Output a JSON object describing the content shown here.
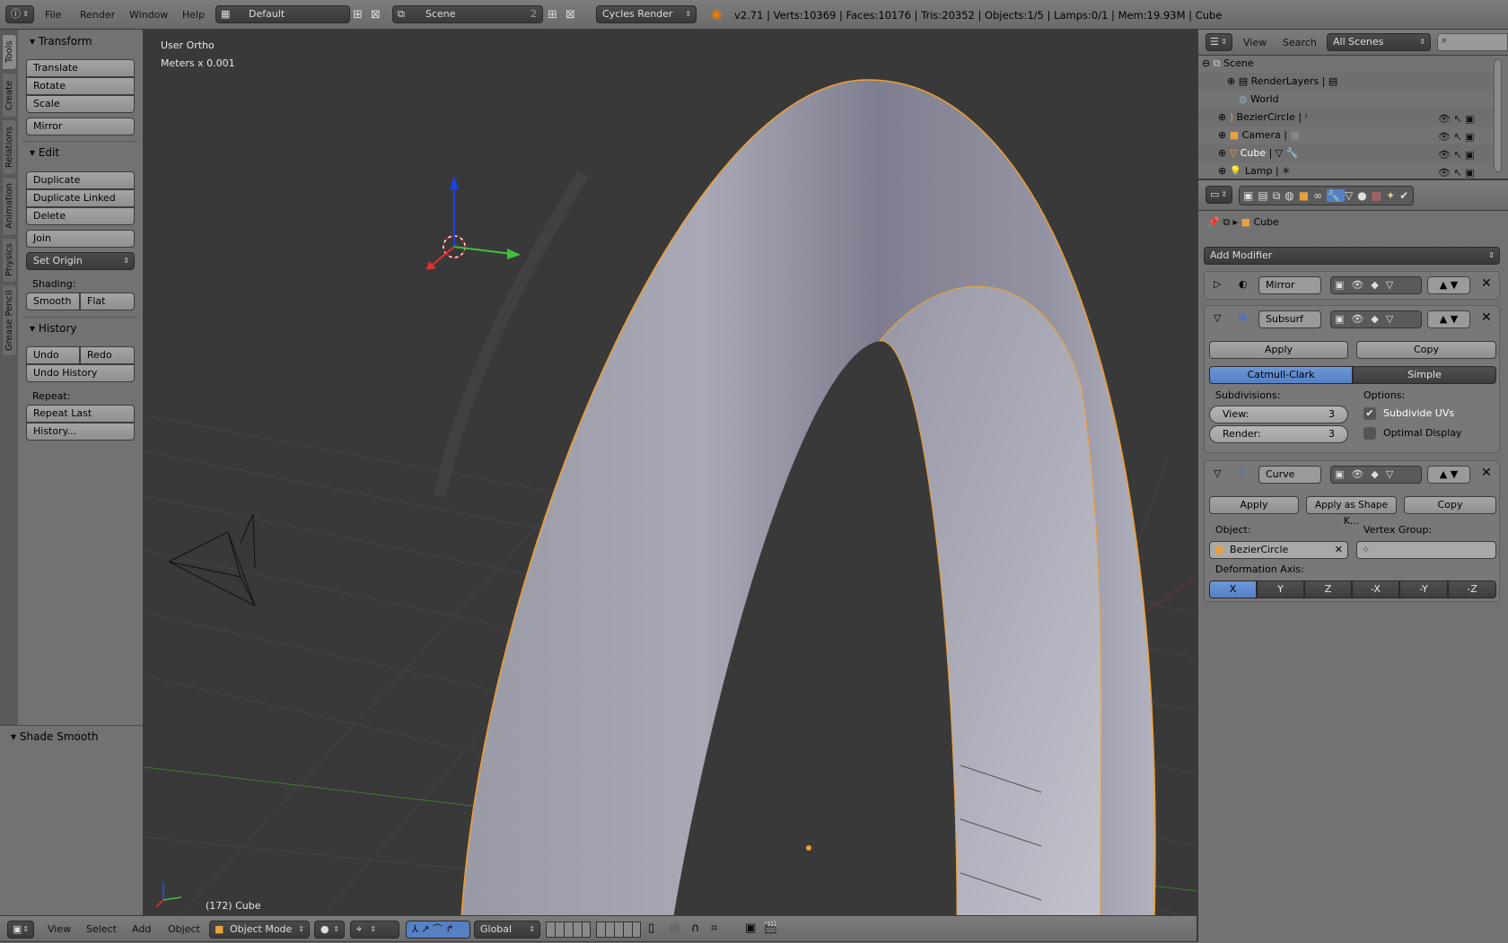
{
  "top_header": {
    "menus": [
      "File",
      "Render",
      "Window",
      "Help"
    ],
    "layout": "Default",
    "scene": "Scene",
    "scene_users": "2",
    "engine": "Cycles Render",
    "stats": "v2.71 | Verts:10369 | Faces:10176 | Tris:20352 | Objects:1/5 | Lamps:0/1 | Mem:19.93M | Cube"
  },
  "tool_tabs": [
    "Tools",
    "Create",
    "Relations",
    "Animation",
    "Physics",
    "Grease Pencil"
  ],
  "toolshelf": {
    "transform": {
      "title": "Transform",
      "buttons": [
        "Translate",
        "Rotate",
        "Scale",
        "Mirror"
      ]
    },
    "edit": {
      "title": "Edit",
      "buttons": [
        "Duplicate",
        "Duplicate Linked",
        "Delete",
        "Join"
      ],
      "set_origin": "Set Origin",
      "shading_label": "Shading:",
      "smooth": "Smooth",
      "flat": "Flat"
    },
    "history": {
      "title": "History",
      "undo": "Undo",
      "redo": "Redo",
      "undo_history": "Undo History",
      "repeat_label": "Repeat:",
      "repeat_last": "Repeat Last",
      "history": "History..."
    },
    "operator": {
      "title": "Shade Smooth"
    }
  },
  "viewport": {
    "view_name": "User Ortho",
    "units": "Meters x 0.001",
    "object_info": "(172) Cube",
    "colors": {
      "background": "#393939",
      "selection_outline": "#f0a030",
      "x_axis": "#c03030",
      "y_axis": "#50b030"
    }
  },
  "bottom_header": {
    "menus": [
      "View",
      "Select",
      "Add",
      "Object"
    ],
    "mode": "Object Mode",
    "orientation": "Global"
  },
  "outliner": {
    "menus": [
      "View",
      "Search"
    ],
    "display": "All Scenes",
    "search_placeholder": "",
    "items": [
      {
        "name": "Scene",
        "icon": "scene-icon"
      },
      {
        "name": "RenderLayers",
        "icon": "renderlayers-icon"
      },
      {
        "name": "World",
        "icon": "world-icon"
      },
      {
        "name": "BezierCircle",
        "icon": "curve-icon"
      },
      {
        "name": "Camera",
        "icon": "camera-icon"
      },
      {
        "name": "Cube",
        "icon": "mesh-icon",
        "selected": true
      },
      {
        "name": "Lamp",
        "icon": "lamp-icon"
      }
    ]
  },
  "properties": {
    "context_object": "Cube",
    "active_tab": "modifiers",
    "add_modifier": "Add Modifier",
    "modifiers": [
      {
        "name": "Mirror",
        "expanded": false
      },
      {
        "name": "Subsurf",
        "expanded": true,
        "apply": "Apply",
        "copy": "Copy",
        "algorithms": [
          "Catmull-Clark",
          "Simple"
        ],
        "active_algorithm": "Catmull-Clark",
        "subdivisions_label": "Subdivisions:",
        "view_label": "View:",
        "view": "3",
        "render_label": "Render:",
        "render": "3",
        "options_label": "Options:",
        "subdivide_uvs": "Subdivide UVs",
        "subdivide_uvs_checked": true,
        "optimal_display": "Optimal Display",
        "optimal_display_checked": false
      },
      {
        "name": "Curve",
        "expanded": true,
        "apply": "Apply",
        "apply_shape": "Apply as Shape K...",
        "copy": "Copy",
        "object_label": "Object:",
        "object": "BezierCircle",
        "vgroup_label": "Vertex Group:",
        "vgroup": "",
        "axis_label": "Deformation Axis:",
        "axes": [
          "X",
          "Y",
          "Z",
          "-X",
          "-Y",
          "-Z"
        ],
        "active_axis": "X"
      }
    ],
    "accent": "#5680c4"
  }
}
